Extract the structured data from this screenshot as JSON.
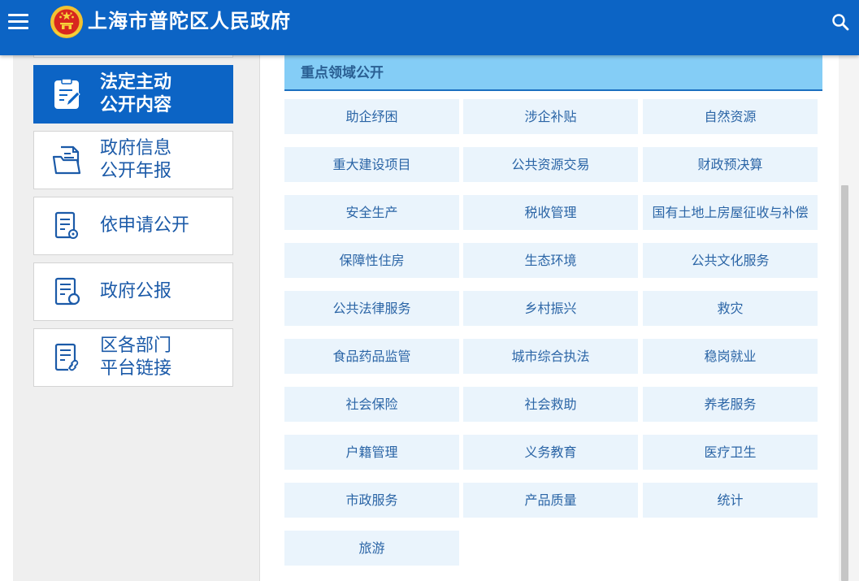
{
  "header": {
    "site_title": "上海市普陀区人民政府",
    "menu_icon": "hamburger-menu-icon",
    "emblem_icon": "national-emblem-icon",
    "search_icon": "search-icon",
    "colors": {
      "header_bg": "#0c64c5",
      "accent": "#84cdf6"
    }
  },
  "sidebar": {
    "items": [
      {
        "line1": "法定主动",
        "line2": "公开内容",
        "icon": "document-edit-icon",
        "active": true
      },
      {
        "line1": "政府信息",
        "line2": "公开年报",
        "icon": "report-folder-icon",
        "active": false
      },
      {
        "line1": "依申请公开",
        "line2": "",
        "icon": "application-form-icon",
        "active": false
      },
      {
        "line1": "政府公报",
        "line2": "",
        "icon": "gazette-icon",
        "active": false
      },
      {
        "line1": "区各部门",
        "line2": "平台链接",
        "icon": "link-document-icon",
        "active": false
      }
    ]
  },
  "main": {
    "section_title": "重点领域公开",
    "topics": [
      "助企纾困",
      "涉企补贴",
      "自然资源",
      "重大建设项目",
      "公共资源交易",
      "财政预决算",
      "安全生产",
      "税收管理",
      "国有土地上房屋征收与补偿",
      "保障性住房",
      "生态环境",
      "公共文化服务",
      "公共法律服务",
      "乡村振兴",
      "救灾",
      "食品药品监管",
      "城市综合执法",
      "稳岗就业",
      "社会保险",
      "社会救助",
      "养老服务",
      "户籍管理",
      "义务教育",
      "医疗卫生",
      "市政服务",
      "产品质量",
      "统计",
      "旅游"
    ]
  }
}
